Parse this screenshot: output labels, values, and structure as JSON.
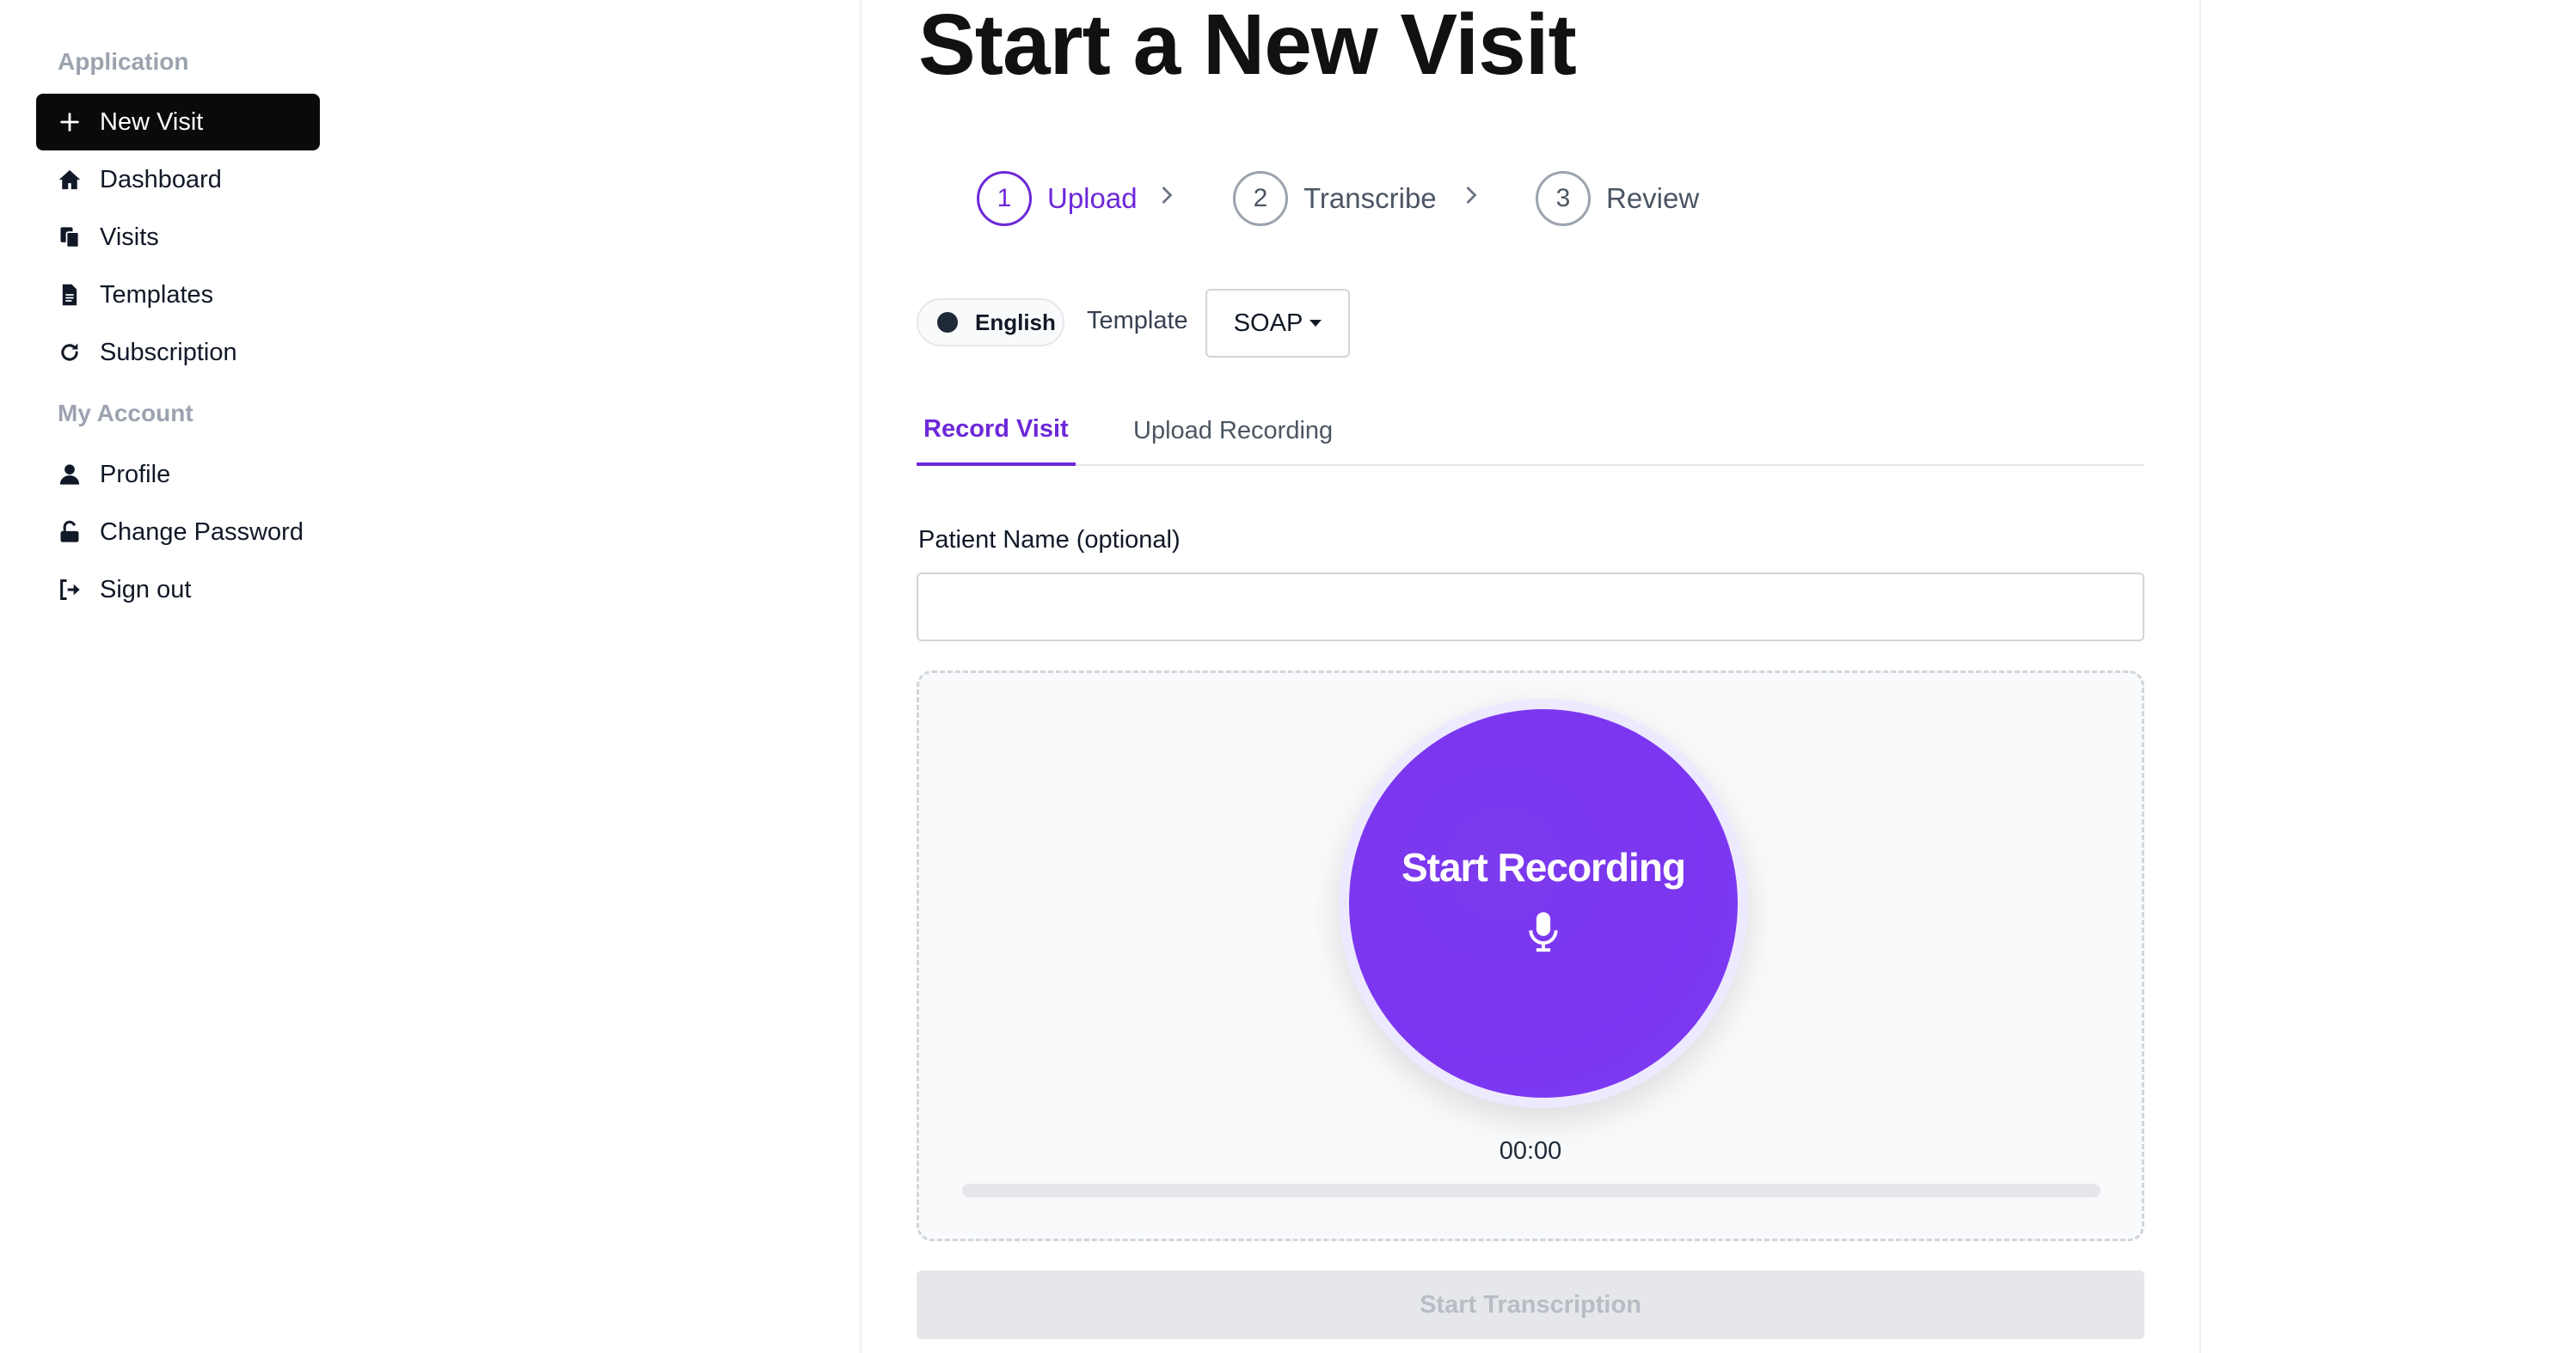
{
  "sidebar": {
    "sections": [
      {
        "label": "Application"
      },
      {
        "label": "My Account"
      }
    ],
    "items": [
      {
        "label": "New Visit",
        "icon": "plus-icon",
        "active": true
      },
      {
        "label": "Dashboard",
        "icon": "home-icon"
      },
      {
        "label": "Visits",
        "icon": "copy-icon"
      },
      {
        "label": "Templates",
        "icon": "document-icon"
      },
      {
        "label": "Subscription",
        "icon": "refresh-icon"
      },
      {
        "label": "Profile",
        "icon": "user-icon"
      },
      {
        "label": "Change Password",
        "icon": "lock-icon"
      },
      {
        "label": "Sign out",
        "icon": "sign-out-icon"
      }
    ]
  },
  "main": {
    "title": "Start a New Visit",
    "steps": [
      {
        "number": "1",
        "label": "Upload",
        "active": true
      },
      {
        "number": "2",
        "label": "Transcribe"
      },
      {
        "number": "3",
        "label": "Review"
      }
    ],
    "language": {
      "label": "English"
    },
    "template": {
      "label": "Template",
      "value": "SOAP"
    },
    "tabs": [
      {
        "label": "Record Visit",
        "active": true
      },
      {
        "label": "Upload Recording"
      }
    ],
    "patient": {
      "label": "Patient Name (optional)",
      "value": "",
      "placeholder": ""
    },
    "recorder": {
      "button_label": "Start Recording",
      "timer": "00:00",
      "progress": 0
    },
    "transcribe_label": "Start Transcription"
  },
  "colors": {
    "accent": "#7c3aed",
    "accent_text": "#6d28d9",
    "active_nav_bg": "#0a0a0a",
    "disabled_bg": "#e5e7eb"
  }
}
